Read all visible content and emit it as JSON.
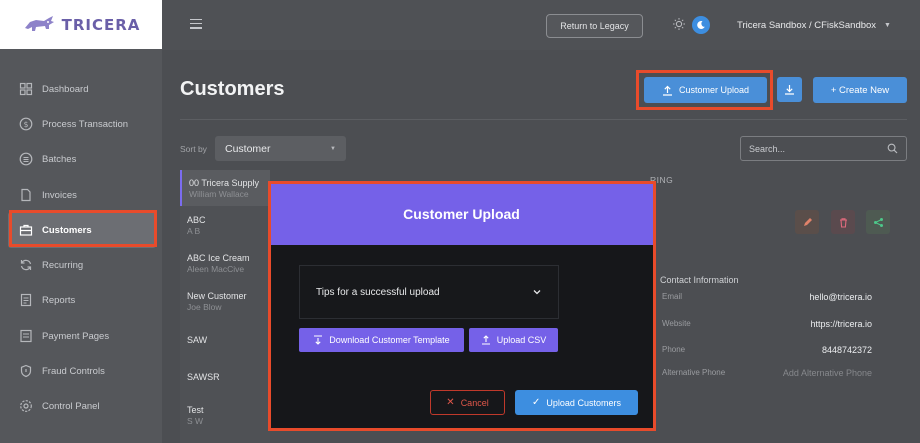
{
  "brand": {
    "name": "TRICERA"
  },
  "sidebar": {
    "items": [
      {
        "label": "Dashboard",
        "icon": "grid-icon"
      },
      {
        "label": "Process Transaction",
        "icon": "dollar-circle-icon"
      },
      {
        "label": "Batches",
        "icon": "list-circle-icon"
      },
      {
        "label": "Invoices",
        "icon": "document-icon"
      },
      {
        "label": "Customers",
        "icon": "briefcase-icon",
        "active": true
      },
      {
        "label": "Recurring",
        "icon": "refresh-icon"
      },
      {
        "label": "Reports",
        "icon": "report-icon"
      },
      {
        "label": "Payment Pages",
        "icon": "page-icon"
      },
      {
        "label": "Fraud Controls",
        "icon": "shield-icon"
      },
      {
        "label": "Control Panel",
        "icon": "gear-icon"
      }
    ]
  },
  "topbar": {
    "legacy_label": "Return to Legacy",
    "account": "Tricera Sandbox / CFiskSandbox"
  },
  "main": {
    "title": "Customers",
    "upload_label": "Customer Upload",
    "create_label": "+ Create New",
    "sort_label": "Sort by",
    "sort_value": "Customer",
    "search_placeholder": "Search...",
    "customers": [
      {
        "name": "00 Tricera Supply",
        "sub": "William Wallace",
        "selected": true
      },
      {
        "name": "ABC",
        "sub": "A B"
      },
      {
        "name": "ABC Ice Cream",
        "sub": "Aleen MacCive"
      },
      {
        "name": "New Customer",
        "sub": "Joe Blow"
      },
      {
        "name": "SAW",
        "sub": ""
      },
      {
        "name": "SAWSR",
        "sub": ""
      },
      {
        "name": "Test",
        "sub": "S W"
      }
    ],
    "detail_header": "RING",
    "contact": {
      "heading": "Contact Information",
      "rows": [
        {
          "key": "Email",
          "value": "hello@tricera.io"
        },
        {
          "key": "Website",
          "value": "https://tricera.io"
        },
        {
          "key": "Phone",
          "value": "8448742372"
        },
        {
          "key": "Alternative Phone",
          "value": "Add Alternative Phone",
          "placeholder": true
        }
      ]
    }
  },
  "modal": {
    "title": "Customer Upload",
    "tips_label": "Tips for a successful upload",
    "template_label": "Download Customer Template",
    "csv_label": "Upload CSV",
    "cancel_label": "Cancel",
    "confirm_label": "Upload Customers"
  },
  "colors": {
    "accent": "#7561e8",
    "primary": "#4a8fd8",
    "highlight": "#e84b2b"
  }
}
